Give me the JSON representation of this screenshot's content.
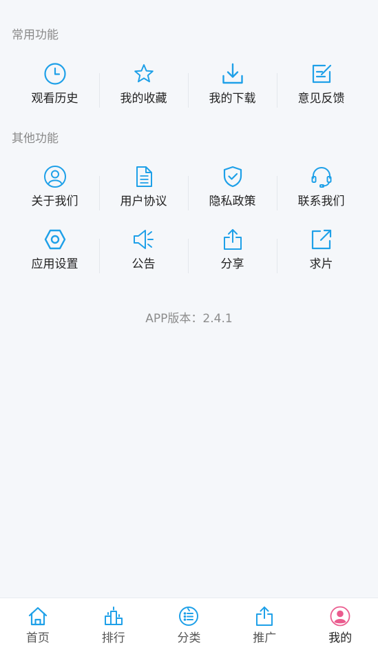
{
  "colors": {
    "accent": "#1ea0e8",
    "active_tab": "#ea5b8e",
    "background": "#f5f7fa"
  },
  "common": {
    "title": "常用功能",
    "items": [
      {
        "label": "观看历史",
        "icon": "clock-icon"
      },
      {
        "label": "我的收藏",
        "icon": "star-icon"
      },
      {
        "label": "我的下载",
        "icon": "download-icon"
      },
      {
        "label": "意见反馈",
        "icon": "feedback-edit-icon"
      }
    ]
  },
  "other": {
    "title": "其他功能",
    "items": [
      {
        "label": "关于我们",
        "icon": "user-circle-icon"
      },
      {
        "label": "用户协议",
        "icon": "document-icon"
      },
      {
        "label": "隐私政策",
        "icon": "shield-check-icon"
      },
      {
        "label": "联系我们",
        "icon": "headset-icon"
      },
      {
        "label": "应用设置",
        "icon": "settings-hexagon-icon"
      },
      {
        "label": "公告",
        "icon": "speaker-icon"
      },
      {
        "label": "分享",
        "icon": "share-icon"
      },
      {
        "label": "求片",
        "icon": "external-link-icon"
      }
    ]
  },
  "version": "APP版本：2.4.1",
  "tabs": [
    {
      "label": "首页",
      "icon": "home-icon"
    },
    {
      "label": "排行",
      "icon": "ranking-icon"
    },
    {
      "label": "分类",
      "icon": "category-list-icon"
    },
    {
      "label": "推广",
      "icon": "share-up-icon"
    },
    {
      "label": "我的",
      "icon": "profile-icon",
      "active": true
    }
  ]
}
